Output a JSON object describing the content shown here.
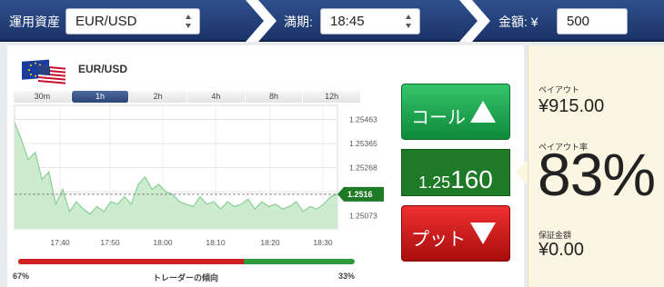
{
  "topbar": {
    "asset_label": "運用資産",
    "asset_value": "EUR/USD",
    "expiry_label": "満期:",
    "expiry_value": "18:45",
    "amount_label": "金額: ¥",
    "amount_value": "500"
  },
  "instrument": {
    "pair": "EUR/USD",
    "flag_icon": "eu-us-flag-icon"
  },
  "tabs": [
    "30m",
    "1h",
    "2h",
    "4h",
    "8h",
    "12h"
  ],
  "active_tab": "1h",
  "chart_data": {
    "type": "area",
    "title": "",
    "x_ticks": [
      "17:40",
      "17:50",
      "18:00",
      "18:10",
      "18:20",
      "18:30"
    ],
    "y_ticks": [
      "1.25463",
      "1.25365",
      "1.25268",
      "1.25170",
      "1.25073"
    ],
    "ylim": [
      1.2502,
      1.2552
    ],
    "current_value": 1.2516,
    "current_label": "1.2516",
    "grid": true,
    "series": [
      {
        "values": [
          1.2545,
          1.2538,
          1.253,
          1.2533,
          1.2522,
          1.2525,
          1.2512,
          1.2518,
          1.2509,
          1.2513,
          1.251,
          1.2508,
          1.2511,
          1.2509,
          1.2513,
          1.2512,
          1.2515,
          1.2512,
          1.252,
          1.2523,
          1.2518,
          1.252,
          1.2517,
          1.2516,
          1.2513,
          1.2512,
          1.2511,
          1.2515,
          1.2512,
          1.2513,
          1.251,
          1.2513,
          1.2511,
          1.2512,
          1.2514,
          1.251,
          1.2513,
          1.2511,
          1.2512,
          1.251,
          1.2511,
          1.2513,
          1.2509,
          1.2511,
          1.251,
          1.2512,
          1.2515,
          1.2516
        ]
      }
    ],
    "line_color": "#8ed09a",
    "fill_color": "#cdeccf"
  },
  "sentiment": {
    "call_pct": "67%",
    "label": "トレーダーの傾向",
    "put_pct": "33%",
    "call_fraction": 0.67
  },
  "buttons": {
    "call_label": "コール",
    "put_label": "プット"
  },
  "price": {
    "prefix": "1.25",
    "main": "160"
  },
  "payout": {
    "payout_label": "ペイアウト",
    "payout_value": "¥915.00",
    "rate_label": "ペイアウト率",
    "rate_value": "83%",
    "guarantee_label": "保証金額",
    "guarantee_value": "¥0.00"
  },
  "colors": {
    "call": "#18a04a",
    "put": "#d11e1e",
    "price": "#1e7a27",
    "topbar": "#243f78"
  }
}
